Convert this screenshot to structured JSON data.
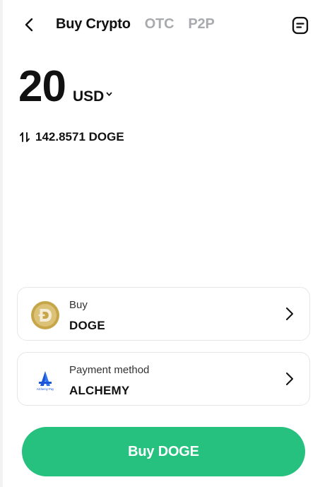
{
  "header": {
    "tabs": [
      {
        "label": "Buy Crypto",
        "active": true
      },
      {
        "label": "OTC",
        "active": false
      },
      {
        "label": "P2P",
        "active": false
      }
    ]
  },
  "amount": {
    "value": "20",
    "currency": "USD"
  },
  "conversion": {
    "value": "142.8571 DOGE"
  },
  "buy_card": {
    "label": "Buy",
    "value": "DOGE",
    "icon": "doge-coin-icon"
  },
  "payment_card": {
    "label": "Payment method",
    "value": "ALCHEMY",
    "icon": "alchemy-pay-logo",
    "logo_text": "Alchemy Pay"
  },
  "cta": {
    "label": "Buy DOGE"
  },
  "colors": {
    "accent": "#26c17f",
    "inactive_tab": "#a8aaae",
    "alchemy_blue": "#1a56d6",
    "doge_gold": "#c7a64a"
  }
}
